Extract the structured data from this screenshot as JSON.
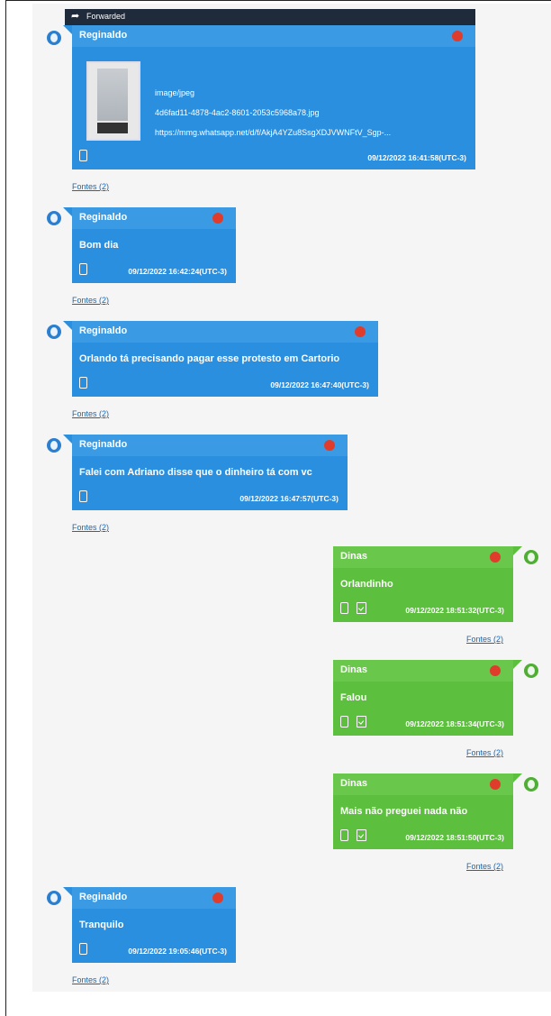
{
  "forwarded_label": "Forwarded",
  "link_label": "Fontes (2)",
  "messages": [
    {
      "sender": "Reginaldo",
      "attachment": {
        "mime": "image/jpeg",
        "filename": "4d6fad11-4878-4ac2-8601-2053c5968a78.jpg",
        "url": "https://mmg.whatsapp.net/d/f/AkjA4YZu8SsgXDJVWNFtV_Sgp-..."
      },
      "timestamp": "09/12/2022 16:41:58(UTC-3)"
    },
    {
      "sender": "Reginaldo",
      "text": "Bom dia",
      "timestamp": "09/12/2022 16:42:24(UTC-3)"
    },
    {
      "sender": "Reginaldo",
      "text": "Orlando tá precisando pagar esse protesto em Cartorio",
      "timestamp": "09/12/2022 16:47:40(UTC-3)"
    },
    {
      "sender": "Reginaldo",
      "text": "Falei com Adriano disse que o dinheiro tá com vc",
      "timestamp": "09/12/2022 16:47:57(UTC-3)"
    },
    {
      "sender": "Dinas",
      "text": "Orlandinho",
      "timestamp": "09/12/2022 18:51:32(UTC-3)"
    },
    {
      "sender": "Dinas",
      "text": "Falou",
      "timestamp": "09/12/2022 18:51:34(UTC-3)"
    },
    {
      "sender": "Dinas",
      "text": "Mais não preguei nada não",
      "timestamp": "09/12/2022 18:51:50(UTC-3)"
    },
    {
      "sender": "Reginaldo",
      "text": "Tranquilo",
      "timestamp": "09/12/2022 19:05:46(UTC-3)"
    }
  ],
  "colors": {
    "incoming": "#2b8fdf",
    "outgoing": "#5cbf3e",
    "status_dot": "#e03c2c"
  },
  "icons": [
    "avatar-icon",
    "phone-icon",
    "delivered-icon",
    "forward-arrow-icon"
  ]
}
